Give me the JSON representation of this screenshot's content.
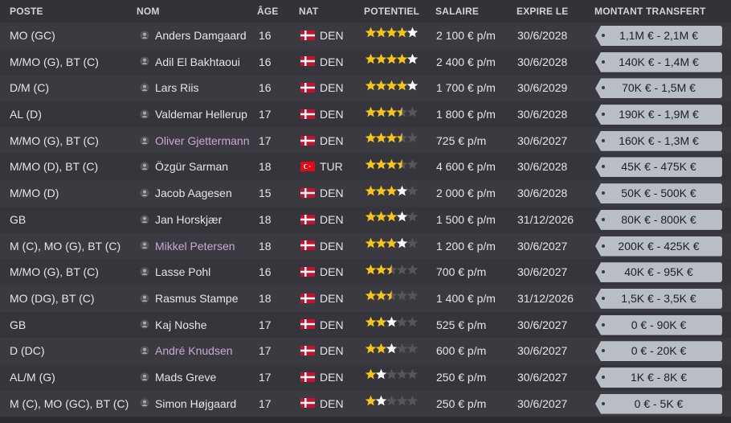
{
  "columns": {
    "position": "POSTE",
    "name": "NOM",
    "age": "ÂGE",
    "nat": "NAT",
    "potential": "POTENTIEL",
    "salary": "SALAIRE",
    "expires": "EXPIRE LE",
    "transfer": "MONTANT TRANSFERT"
  },
  "colors": {
    "star_gold": "#f5c518",
    "star_white": "#ffffff",
    "star_empty": "#55555c",
    "highlight_name": "#c9a8d6",
    "tag_bg": "#b9bec6"
  },
  "icons": {
    "person": "person-icon",
    "star": "star-icon"
  },
  "players": [
    {
      "position": "MO (GC)",
      "name": "Anders Damgaard",
      "highlight": false,
      "age": "16",
      "flag": "denmark",
      "nat": "DEN",
      "stars_gold": 4,
      "star_white": true,
      "stars_half": 0,
      "salary": "2 100 € p/m",
      "expires": "30/6/2028",
      "transfer": "1,1M € - 2,1M €"
    },
    {
      "position": "M/MO (G), BT (C)",
      "name": "Adil El Bakhtaoui",
      "highlight": false,
      "age": "16",
      "flag": "denmark",
      "nat": "DEN",
      "stars_gold": 4,
      "star_white": true,
      "stars_half": 0,
      "salary": "2 400 € p/m",
      "expires": "30/6/2028",
      "transfer": "140K € - 1,4M €"
    },
    {
      "position": "D/M (C)",
      "name": "Lars Riis",
      "highlight": false,
      "age": "16",
      "flag": "denmark",
      "nat": "DEN",
      "stars_gold": 4,
      "star_white": true,
      "stars_half": 0,
      "salary": "1 700 € p/m",
      "expires": "30/6/2029",
      "transfer": "70K € - 1,5M €"
    },
    {
      "position": "AL (D)",
      "name": "Valdemar Hellerup",
      "highlight": false,
      "age": "17",
      "flag": "denmark",
      "nat": "DEN",
      "stars_gold": 3,
      "star_white": false,
      "stars_half": 1,
      "salary": "1 800 € p/m",
      "expires": "30/6/2028",
      "transfer": "190K € - 1,9M €"
    },
    {
      "position": "M/MO (G), BT (C)",
      "name": "Oliver Gjettermann",
      "highlight": true,
      "age": "17",
      "flag": "denmark",
      "nat": "DEN",
      "stars_gold": 3,
      "star_white": false,
      "stars_half": 1,
      "salary": "725 € p/m",
      "expires": "30/6/2027",
      "transfer": "160K € - 1,3M €"
    },
    {
      "position": "M/MO (D), BT (C)",
      "name": "Özgür Sarman",
      "highlight": false,
      "age": "18",
      "flag": "turkey",
      "nat": "TUR",
      "stars_gold": 3,
      "star_white": false,
      "stars_half": 1,
      "salary": "4 600 € p/m",
      "expires": "30/6/2028",
      "transfer": "45K € - 475K €"
    },
    {
      "position": "M/MO (D)",
      "name": "Jacob Aagesen",
      "highlight": false,
      "age": "15",
      "flag": "denmark",
      "nat": "DEN",
      "stars_gold": 3,
      "star_white": true,
      "stars_half": 0,
      "salary": "2 000 € p/m",
      "expires": "30/6/2028",
      "transfer": "50K € - 500K €"
    },
    {
      "position": "GB",
      "name": "Jan Horskjær",
      "highlight": false,
      "age": "18",
      "flag": "denmark",
      "nat": "DEN",
      "stars_gold": 3,
      "star_white": true,
      "stars_half": 0,
      "salary": "1 500 € p/m",
      "expires": "31/12/2026",
      "transfer": "80K € - 800K €"
    },
    {
      "position": "M (C), MO (G), BT (C)",
      "name": "Mikkel Petersen",
      "highlight": true,
      "age": "18",
      "flag": "denmark",
      "nat": "DEN",
      "stars_gold": 3,
      "star_white": true,
      "stars_half": 0,
      "salary": "1 200 € p/m",
      "expires": "30/6/2027",
      "transfer": "200K € - 425K €"
    },
    {
      "position": "M/MO (G), BT (C)",
      "name": "Lasse Pohl",
      "highlight": false,
      "age": "16",
      "flag": "denmark",
      "nat": "DEN",
      "stars_gold": 2,
      "star_white": false,
      "stars_half": 1,
      "salary": "700 € p/m",
      "expires": "30/6/2027",
      "transfer": "40K € - 95K €"
    },
    {
      "position": "MO (DG), BT (C)",
      "name": "Rasmus Stampe",
      "highlight": false,
      "age": "18",
      "flag": "denmark",
      "nat": "DEN",
      "stars_gold": 2,
      "star_white": false,
      "stars_half": 1,
      "salary": "1 400 € p/m",
      "expires": "31/12/2026",
      "transfer": "1,5K € - 3,5K €"
    },
    {
      "position": "GB",
      "name": "Kaj Noshe",
      "highlight": false,
      "age": "17",
      "flag": "denmark",
      "nat": "DEN",
      "stars_gold": 2,
      "star_white": true,
      "stars_half": 0,
      "salary": "525 € p/m",
      "expires": "30/6/2027",
      "transfer": "0 € - 90K €"
    },
    {
      "position": "D (DC)",
      "name": "André Knudsen",
      "highlight": true,
      "age": "17",
      "flag": "denmark",
      "nat": "DEN",
      "stars_gold": 2,
      "star_white": true,
      "stars_half": 0,
      "salary": "600 € p/m",
      "expires": "30/6/2027",
      "transfer": "0 € - 20K €"
    },
    {
      "position": "AL/M (G)",
      "name": "Mads Greve",
      "highlight": false,
      "age": "17",
      "flag": "denmark",
      "nat": "DEN",
      "stars_gold": 1,
      "star_white": true,
      "stars_half": 0,
      "salary": "250 € p/m",
      "expires": "30/6/2027",
      "transfer": "1K € - 8K €"
    },
    {
      "position": "M (C), MO (GC), BT (C)",
      "name": "Simon Højgaard",
      "highlight": false,
      "age": "17",
      "flag": "denmark",
      "nat": "DEN",
      "stars_gold": 1,
      "star_white": true,
      "stars_half": 0,
      "salary": "250 € p/m",
      "expires": "30/6/2027",
      "transfer": "0 € - 5K €"
    }
  ]
}
